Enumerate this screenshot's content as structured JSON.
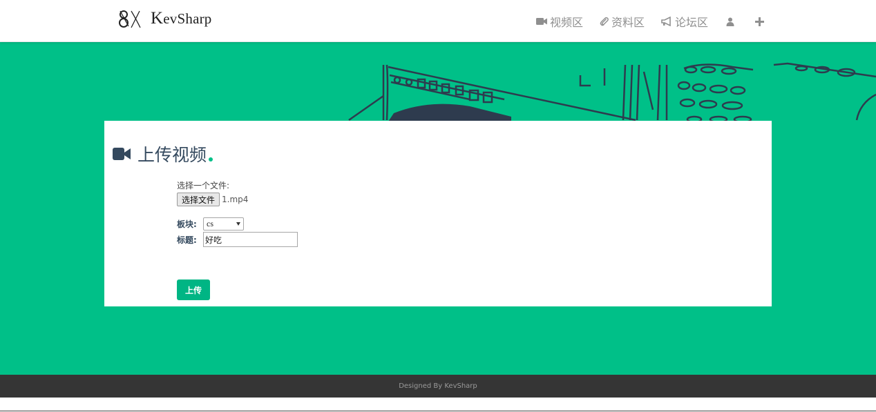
{
  "brand": {
    "name_cap": "K",
    "name_rest": "evSharp"
  },
  "nav": {
    "items": [
      {
        "label": "视频区",
        "icon": "video-camera-icon"
      },
      {
        "label": "资料区",
        "icon": "paperclip-icon"
      },
      {
        "label": "论坛区",
        "icon": "bullhorn-icon"
      }
    ],
    "user_icon": "user-icon",
    "add_icon": "plus-icon"
  },
  "page": {
    "title": "上传视频",
    "title_icon": "video-camera-icon"
  },
  "form": {
    "file_label": "选择一个文件:",
    "file_button": "选择文件",
    "file_name": "1.mp4",
    "section_label": "板块:",
    "section_value": "cs",
    "title_label": "标题:",
    "title_value": "好吃",
    "submit_label": "上传"
  },
  "footer": {
    "text": "Designed By KevSharp"
  },
  "colors": {
    "accent": "#00c088",
    "footer_bg": "#353535",
    "title": "#34495e"
  }
}
